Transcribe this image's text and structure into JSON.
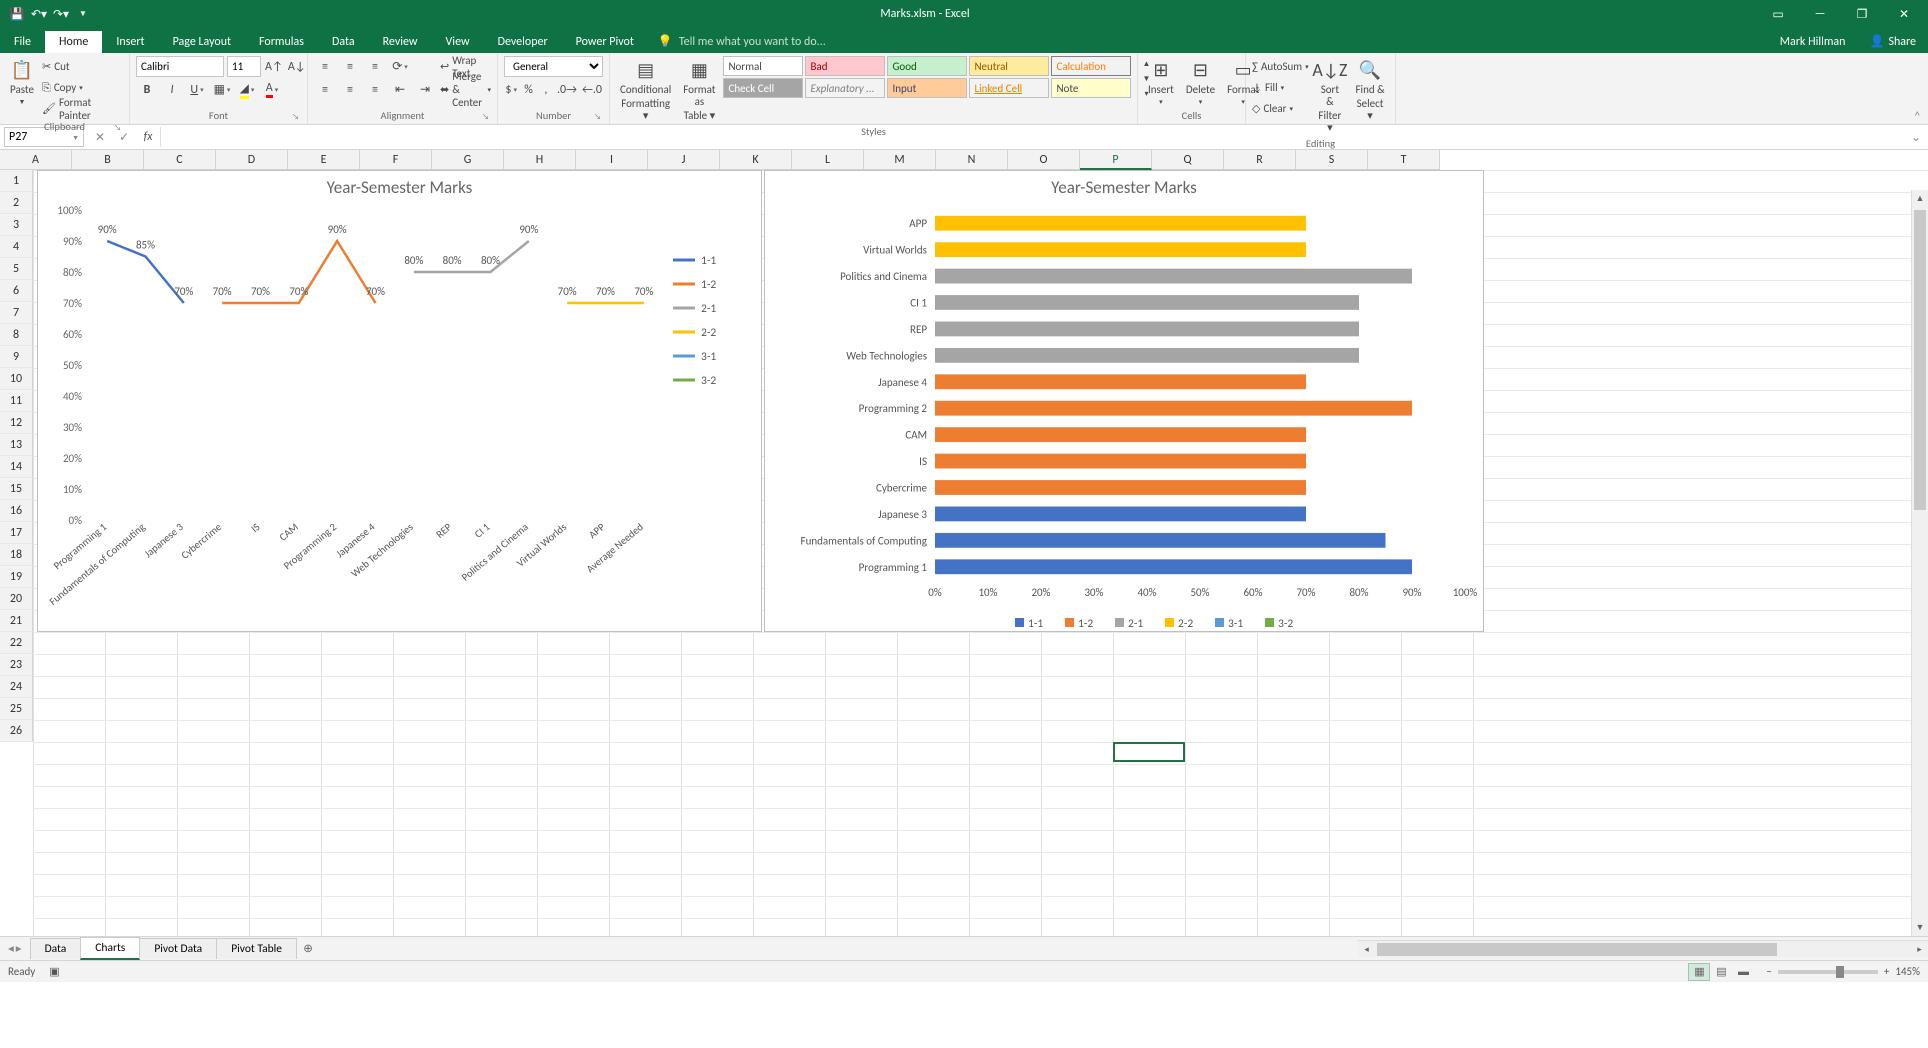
{
  "app": {
    "title": "Marks.xlsm - Excel"
  },
  "qat": {
    "save": "💾",
    "undo": "↶",
    "redo": "↷"
  },
  "tabs": {
    "file": "File",
    "home": "Home",
    "insert": "Insert",
    "pageLayout": "Page Layout",
    "formulas": "Formulas",
    "data": "Data",
    "review": "Review",
    "view": "View",
    "developer": "Developer",
    "powerPivot": "Power Pivot",
    "tellme": "Tell me what you want to do..."
  },
  "user": "Mark Hillman",
  "share": "Share",
  "ribbon": {
    "clipboard": {
      "label": "Clipboard",
      "paste": "Paste",
      "cut": "Cut",
      "copy": "Copy",
      "painter": "Format Painter"
    },
    "font": {
      "label": "Font",
      "name": "Calibri",
      "size": "11"
    },
    "alignment": {
      "label": "Alignment",
      "wrap": "Wrap Text",
      "merge": "Merge & Center"
    },
    "number": {
      "label": "Number",
      "format": "General"
    },
    "stylesGroup": {
      "label": "Styles",
      "cond": "Conditional",
      "cond2": "Formatting",
      "fmt": "Format as",
      "fmt2": "Table",
      "cells": {
        "normal": "Normal",
        "bad": "Bad",
        "good": "Good",
        "neutral": "Neutral",
        "calculation": "Calculation",
        "check": "Check Cell",
        "explan": "Explanatory ...",
        "input": "Input",
        "linked": "Linked Cell",
        "note": "Note"
      }
    },
    "cells": {
      "label": "Cells",
      "insert": "Insert",
      "delete": "Delete",
      "format": "Format"
    },
    "editing": {
      "label": "Editing",
      "autosum": "AutoSum",
      "fill": "Fill",
      "clear": "Clear",
      "sort": "Sort &",
      "sort2": "Filter",
      "find": "Find &",
      "find2": "Select"
    }
  },
  "namebox": "P27",
  "columns": [
    "A",
    "B",
    "C",
    "D",
    "E",
    "F",
    "G",
    "H",
    "I",
    "J",
    "K",
    "L",
    "M",
    "N",
    "O",
    "P",
    "Q",
    "R",
    "S",
    "T"
  ],
  "rows": [
    "1",
    "2",
    "3",
    "4",
    "5",
    "6",
    "7",
    "8",
    "9",
    "10",
    "11",
    "12",
    "13",
    "14",
    "15",
    "16",
    "17",
    "18",
    "19",
    "20",
    "21",
    "22",
    "23",
    "24",
    "25",
    "26"
  ],
  "sheets": {
    "data": "Data",
    "charts": "Charts",
    "pivotData": "Pivot Data",
    "pivotTable": "Pivot Table"
  },
  "status": {
    "ready": "Ready",
    "zoom": "145%"
  },
  "chart_data": [
    {
      "type": "line",
      "title": "Year-Semester Marks",
      "ylabel": "",
      "xlabel": "",
      "ylim": [
        0,
        100
      ],
      "yticks": [
        "0%",
        "10%",
        "20%",
        "30%",
        "40%",
        "50%",
        "60%",
        "70%",
        "80%",
        "90%",
        "100%"
      ],
      "categories": [
        "Programming 1",
        "Fundamentals of Computing",
        "Japanese 3",
        "Cybercrime",
        "IS",
        "CAM",
        "Programming 2",
        "Japanese 4",
        "Web Technologies",
        "REP",
        "CI 1",
        "Politics and Cinema",
        "Virtual Worlds",
        "APP",
        "Average Needed"
      ],
      "series": [
        {
          "name": "1-1",
          "color": "#4472C4",
          "values": [
            90,
            85,
            70,
            null,
            null,
            null,
            null,
            null,
            null,
            null,
            null,
            null,
            null,
            null,
            null
          ]
        },
        {
          "name": "1-2",
          "color": "#ED7D31",
          "values": [
            null,
            null,
            null,
            70,
            70,
            70,
            90,
            70,
            null,
            null,
            null,
            null,
            null,
            null,
            null
          ]
        },
        {
          "name": "2-1",
          "color": "#A5A5A5",
          "values": [
            null,
            null,
            null,
            null,
            null,
            null,
            null,
            null,
            80,
            80,
            80,
            90,
            null,
            null,
            null
          ]
        },
        {
          "name": "2-2",
          "color": "#FFC000",
          "values": [
            null,
            null,
            null,
            null,
            null,
            null,
            null,
            null,
            null,
            null,
            null,
            null,
            70,
            70,
            70
          ]
        },
        {
          "name": "3-1",
          "color": "#5B9BD5",
          "values": [
            null,
            null,
            null,
            null,
            null,
            null,
            null,
            null,
            null,
            null,
            null,
            null,
            null,
            null,
            null
          ]
        },
        {
          "name": "3-2",
          "color": "#70AD47",
          "values": [
            null,
            null,
            null,
            null,
            null,
            null,
            null,
            null,
            null,
            null,
            null,
            null,
            null,
            null,
            null
          ]
        }
      ],
      "legend_position": "right"
    },
    {
      "type": "bar",
      "title": "Year-Semester Marks",
      "xlim": [
        0,
        100
      ],
      "xticks": [
        "0%",
        "10%",
        "20%",
        "30%",
        "40%",
        "50%",
        "60%",
        "70%",
        "80%",
        "90%",
        "100%"
      ],
      "categories": [
        "Programming 1",
        "Fundamentals of Computing",
        "Japanese 3",
        "Cybercrime",
        "IS",
        "CAM",
        "Programming 2",
        "Japanese 4",
        "Web Technologies",
        "REP",
        "CI 1",
        "Politics and Cinema",
        "Virtual Worlds",
        "APP"
      ],
      "series": [
        {
          "name": "1-1",
          "color": "#4472C4",
          "values": [
            90,
            85,
            70,
            null,
            null,
            null,
            null,
            null,
            null,
            null,
            null,
            null,
            null,
            null
          ]
        },
        {
          "name": "1-2",
          "color": "#ED7D31",
          "values": [
            null,
            null,
            null,
            70,
            70,
            70,
            90,
            70,
            null,
            null,
            null,
            null,
            null,
            null
          ]
        },
        {
          "name": "2-1",
          "color": "#A5A5A5",
          "values": [
            null,
            null,
            null,
            null,
            null,
            null,
            null,
            null,
            80,
            80,
            80,
            90,
            null,
            null
          ]
        },
        {
          "name": "2-2",
          "color": "#FFC000",
          "values": [
            null,
            null,
            null,
            null,
            null,
            null,
            null,
            null,
            null,
            null,
            null,
            null,
            70,
            70
          ]
        },
        {
          "name": "3-1",
          "color": "#5B9BD5",
          "values": [
            null,
            null,
            null,
            null,
            null,
            null,
            null,
            null,
            null,
            null,
            null,
            null,
            null,
            null
          ]
        },
        {
          "name": "3-2",
          "color": "#70AD47",
          "values": [
            null,
            null,
            null,
            null,
            null,
            null,
            null,
            null,
            null,
            null,
            null,
            null,
            null,
            null
          ]
        }
      ],
      "legend_position": "bottom"
    }
  ]
}
